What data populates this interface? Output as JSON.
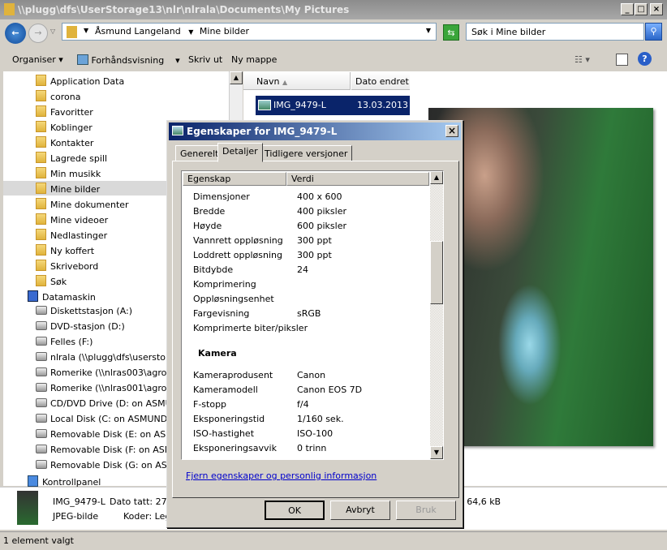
{
  "window": {
    "title": "\\\\plugg\\dfs\\UserStorage13\\nlr\\nlrala\\Documents\\My Pictures"
  },
  "address": {
    "crumbs": [
      "Åsmund Langeland",
      "Mine bilder"
    ]
  },
  "search": {
    "placeholder": "Søk i Mine bilder"
  },
  "toolbar": {
    "organise": "Organiser",
    "preview": "Forhåndsvisning",
    "print": "Skriv ut",
    "new_folder": "Ny mappe"
  },
  "tree": {
    "folders": [
      "Application Data",
      "corona",
      "Favoritter",
      "Koblinger",
      "Kontakter",
      "Lagrede spill",
      "Min musikk",
      "Mine bilder",
      "Mine dokumenter",
      "Mine videoer",
      "Nedlastinger",
      "Ny koffert",
      "Skrivebord",
      "Søk"
    ],
    "computer": "Datamaskin",
    "drives": [
      "Diskettstasjon (A:)",
      "DVD-stasjon (D:)",
      "Felles (F:)",
      "nlrala (\\\\plugg\\dfs\\userstorag",
      "Romerike (\\\\nlras003\\agro_lfr",
      "Romerike (\\\\nlras001\\agro_lfr",
      "CD/DVD Drive (D: on ASMUND",
      "Local Disk (C: on ASMUNDS-P",
      "Removable Disk (E: on ASMUN",
      "Removable Disk (F: on ASMUN",
      "Removable Disk (G: on ASMUN"
    ],
    "control_panel": "Kontrollpanel"
  },
  "filelist": {
    "col_name": "Navn",
    "col_date": "Dato endret",
    "rows": [
      {
        "name": "IMG_9479-L",
        "date": "13.03.2013 1"
      }
    ]
  },
  "details": {
    "name": "IMG_9479-L",
    "date_taken": "Dato tatt: 27.0",
    "type": "JPEG-bilde",
    "encoders": "Koder: Leg",
    "size": ": 64,6 kB"
  },
  "status": {
    "text": "1 element valgt"
  },
  "dialog": {
    "title": "Egenskaper for IMG_9479-L",
    "tabs": [
      "Generelt",
      "Detaljer",
      "Tidligere versjoner"
    ],
    "active_tab": "Detaljer",
    "col_property": "Egenskap",
    "col_value": "Verdi",
    "rows": [
      {
        "k": "Dimensjoner",
        "v": "400 x 600"
      },
      {
        "k": "Bredde",
        "v": "400 piksler"
      },
      {
        "k": "Høyde",
        "v": "600 piksler"
      },
      {
        "k": "Vannrett oppløsning",
        "v": "300 ppt"
      },
      {
        "k": "Loddrett oppløsning",
        "v": "300 ppt"
      },
      {
        "k": "Bitdybde",
        "v": "24"
      },
      {
        "k": "Komprimering",
        "v": ""
      },
      {
        "k": "Oppløsningsenhet",
        "v": ""
      },
      {
        "k": "Fargevisning",
        "v": "sRGB"
      },
      {
        "k": "Komprimerte biter/piksler",
        "v": ""
      }
    ],
    "section": "Kamera",
    "camera_rows": [
      {
        "k": "Kameraprodusent",
        "v": "Canon"
      },
      {
        "k": "Kameramodell",
        "v": "Canon EOS 7D"
      },
      {
        "k": "F-stopp",
        "v": "f/4"
      },
      {
        "k": "Eksponeringstid",
        "v": "1/160 sek."
      },
      {
        "k": "ISO-hastighet",
        "v": "ISO-100"
      },
      {
        "k": "Eksponeringsavvik",
        "v": "0 trinn"
      }
    ],
    "link": "Fjern egenskaper og personlig informasjon",
    "ok": "OK",
    "cancel": "Avbryt",
    "apply": "Bruk"
  }
}
